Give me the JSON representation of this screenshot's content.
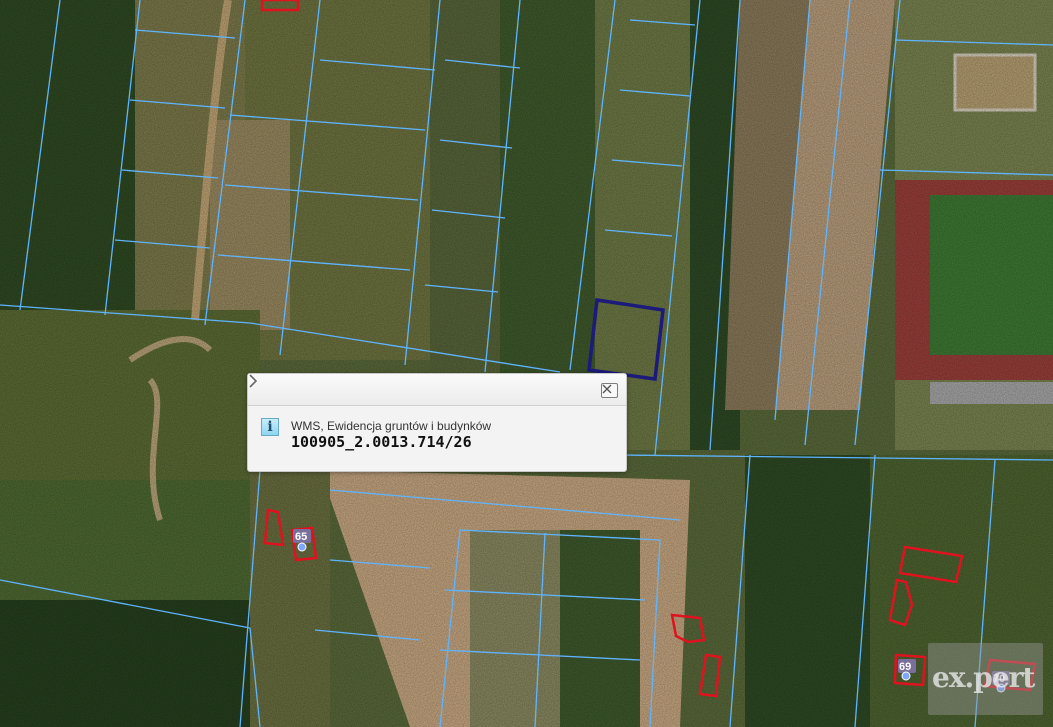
{
  "map": {
    "imagery": "orthophoto",
    "parcel_line_color": "#5fb4ff",
    "building_color": "#e0121f",
    "selected_parcel_color": "#1c1a7a"
  },
  "address_numbers": [
    {
      "label": "65"
    },
    {
      "label": "69"
    },
    {
      "label": "70"
    }
  ],
  "popup": {
    "info_icon": "info-icon",
    "source": "WMS, Ewidencja gruntów i budynków",
    "parcel_id": "100905_2.0013.714/26",
    "close_icon": "close-icon",
    "next_icon": "chevron-right-icon"
  },
  "watermark": {
    "text": "ex.pert"
  }
}
